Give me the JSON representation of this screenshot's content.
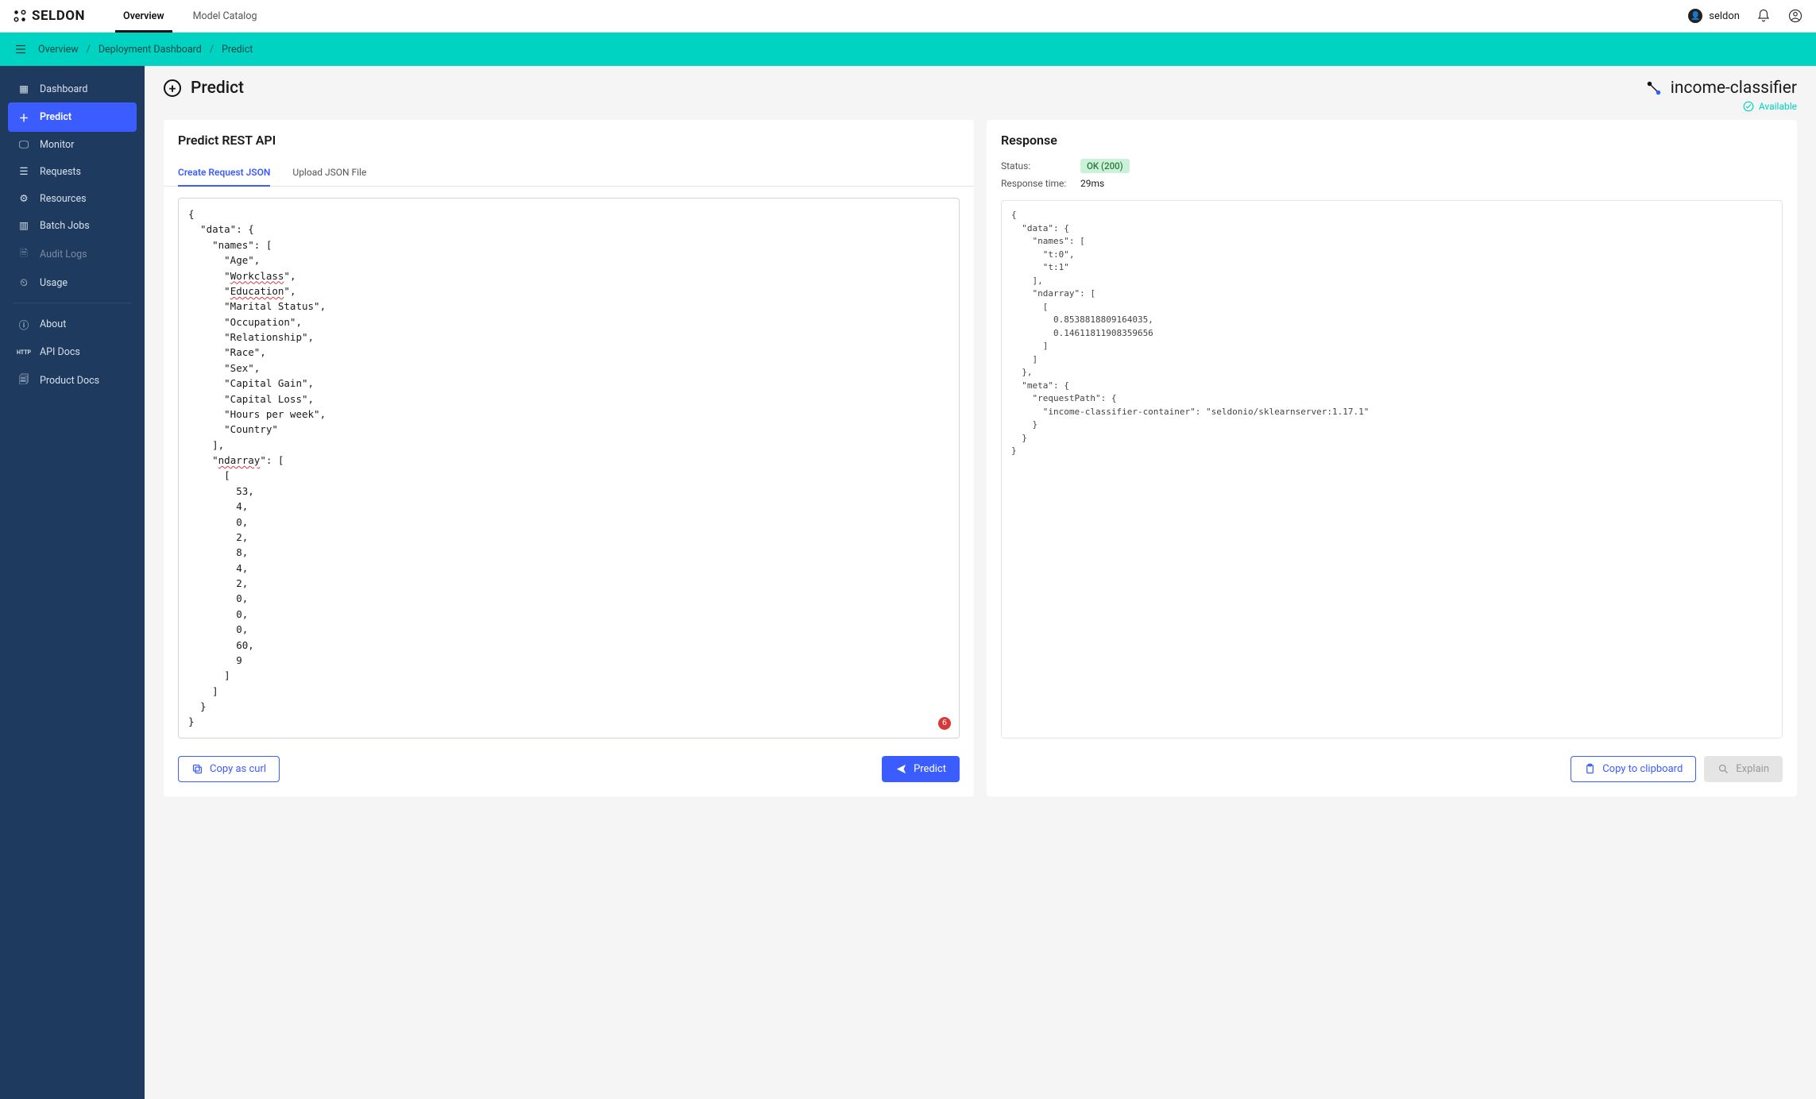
{
  "topbar": {
    "brand": "SELDON",
    "tabs": [
      {
        "label": "Overview",
        "active": true
      },
      {
        "label": "Model Catalog",
        "active": false
      }
    ],
    "user": "seldon"
  },
  "breadcrumb": {
    "items": [
      "Overview",
      "Deployment Dashboard",
      "Predict"
    ]
  },
  "sidebar": {
    "items": [
      {
        "label": "Dashboard",
        "icon": "grid",
        "active": false
      },
      {
        "label": "Predict",
        "icon": "plus",
        "active": true
      },
      {
        "label": "Monitor",
        "icon": "monitor",
        "active": false
      },
      {
        "label": "Requests",
        "icon": "list",
        "active": false
      },
      {
        "label": "Resources",
        "icon": "gear",
        "active": false
      },
      {
        "label": "Batch Jobs",
        "icon": "bars",
        "active": false
      },
      {
        "label": "Audit Logs",
        "icon": "doc",
        "active": false,
        "dim": true
      },
      {
        "label": "Usage",
        "icon": "gauge",
        "active": false
      }
    ],
    "bottom": [
      {
        "label": "About",
        "icon": "info"
      },
      {
        "label": "API Docs",
        "icon": "http"
      },
      {
        "label": "Product Docs",
        "icon": "doc2"
      }
    ]
  },
  "page": {
    "title": "Predict",
    "model_name": "income-classifier",
    "availability": "Available"
  },
  "left_panel": {
    "title": "Predict REST API",
    "tabs": [
      {
        "label": "Create Request JSON",
        "active": true
      },
      {
        "label": "Upload JSON File",
        "active": false
      }
    ],
    "request_json": "{\n  \"data\": {\n    \"names\": [\n      \"Age\",\n      \"Workclass\",\n      \"Education\",\n      \"Marital Status\",\n      \"Occupation\",\n      \"Relationship\",\n      \"Race\",\n      \"Sex\",\n      \"Capital Gain\",\n      \"Capital Loss\",\n      \"Hours per week\",\n      \"Country\"\n    ],\n    \"ndarray\": [\n      [\n        53,\n        4,\n        0,\n        2,\n        8,\n        4,\n        2,\n        0,\n        0,\n        0,\n        60,\n        9\n      ]\n    ]\n  }\n}",
    "error_count": "6",
    "copy_curl": "Copy as curl",
    "predict": "Predict"
  },
  "right_panel": {
    "title": "Response",
    "status_label": "Status:",
    "status_value": "OK (200)",
    "time_label": "Response time:",
    "time_value": "29ms",
    "response_json": "{\n  \"data\": {\n    \"names\": [\n      \"t:0\",\n      \"t:1\"\n    ],\n    \"ndarray\": [\n      [\n        0.8538818809164035,\n        0.14611811908359656\n      ]\n    ]\n  },\n  \"meta\": {\n    \"requestPath\": {\n      \"income-classifier-container\": \"seldonio/sklearnserver:1.17.1\"\n    }\n  }\n}",
    "copy_clip": "Copy to clipboard",
    "explain": "Explain"
  }
}
